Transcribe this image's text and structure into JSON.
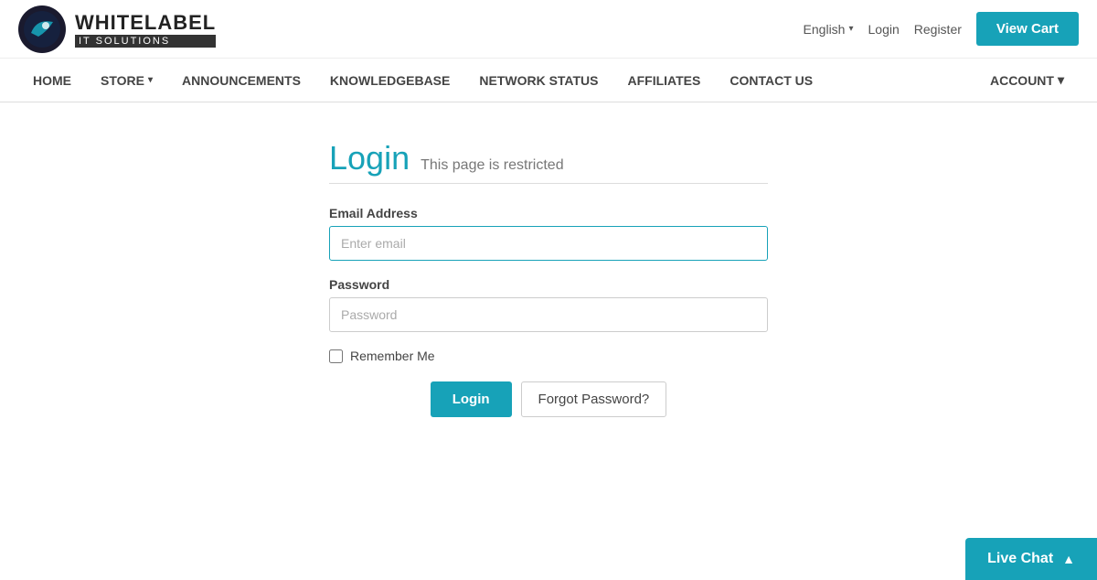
{
  "header": {
    "brand_top": "WHITELABEL",
    "brand_bottom": "IT SOLUTIONS",
    "lang": "English",
    "login_link": "Login",
    "register_link": "Register",
    "view_cart": "View Cart"
  },
  "nav": {
    "items": [
      {
        "label": "HOME",
        "has_caret": false
      },
      {
        "label": "STORE",
        "has_caret": true
      },
      {
        "label": "ANNOUNCEMENTS",
        "has_caret": false
      },
      {
        "label": "KNOWLEDGEBASE",
        "has_caret": false
      },
      {
        "label": "NETWORK STATUS",
        "has_caret": false
      },
      {
        "label": "AFFILIATES",
        "has_caret": false
      },
      {
        "label": "CONTACT US",
        "has_caret": false
      }
    ],
    "account_label": "ACCOUNT"
  },
  "login_page": {
    "heading": "Login",
    "subtitle": "This page is restricted",
    "email_label": "Email Address",
    "email_placeholder": "Enter email",
    "password_label": "Password",
    "password_placeholder": "Password",
    "remember_label": "Remember Me",
    "login_btn": "Login",
    "forgot_btn": "Forgot Password?"
  },
  "live_chat": {
    "label": "Live Chat"
  }
}
